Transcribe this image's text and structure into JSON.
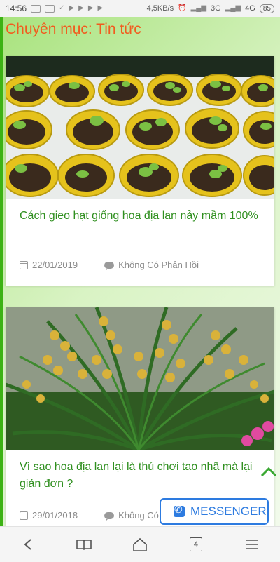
{
  "status_bar": {
    "time": "14:56",
    "network_speed": "4,5KB/s",
    "network_3g": "3G",
    "network_4g": "4G",
    "battery": "85"
  },
  "section": {
    "title": "Chuyên mục: Tin tức"
  },
  "posts": [
    {
      "title": "Cách gieo hạt giống hoa địa lan nảy mầm 100%",
      "date": "22/01/2019",
      "comments": "Không Có Phản Hồi"
    },
    {
      "title": "Vì sao hoa địa lan lại là thú chơi tao nhã mà lại giản đơn ?",
      "date": "29/01/2018",
      "comments": "Không Có Phản Hồi"
    }
  ],
  "messenger": {
    "label": "MESSENGER"
  },
  "browser_nav": {
    "tab_count": "4"
  },
  "colors": {
    "accent_green": "#2f8f1f",
    "title_orange": "#f25b1e",
    "messenger_blue": "#2d7be0"
  }
}
